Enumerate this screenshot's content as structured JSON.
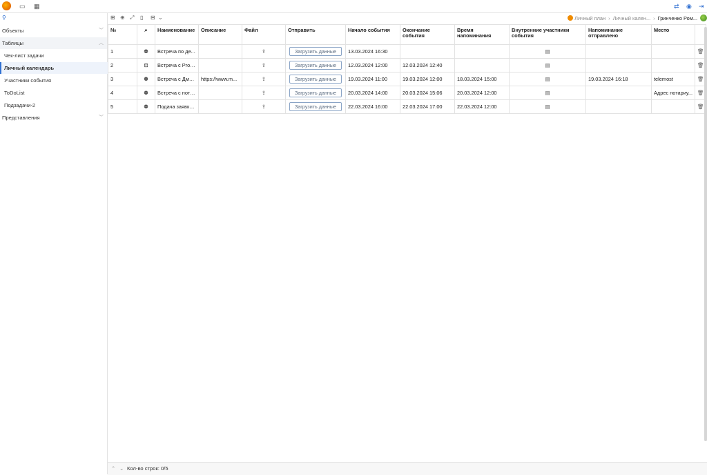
{
  "topbar": {
    "icons": [
      "monitor-icon",
      "grid-icon"
    ],
    "right_icons": [
      "swap-icon",
      "user-circle-icon",
      "logout-icon"
    ]
  },
  "sidebar": {
    "objects_label": "Объекты",
    "tables_label": "Таблицы",
    "table_items": [
      "Чек-лист задачи",
      "Личный календарь",
      "Участники события",
      "ToDoList",
      "Подзадачи-2"
    ],
    "active_item": "Личный календарь",
    "views_label": "Представления"
  },
  "breadcrumb": {
    "items": [
      "Личный план",
      "Личный кален...",
      "Гринченко Ром..."
    ]
  },
  "table": {
    "headers": [
      "№",
      "",
      "Наименование",
      "Описание",
      "Файл",
      "Отправить",
      "Начало события",
      "Окончание события",
      "Время напоминания",
      "Внутренние участники события",
      "Напоминание отправлено",
      "Место",
      ""
    ],
    "upload_label": "Загрузить данные",
    "rows": [
      {
        "num": "1",
        "name": "Встреча по де...",
        "desc": "",
        "start": "13.03.2024 16:30",
        "end": "",
        "remind": "",
        "sent": "",
        "place": ""
      },
      {
        "num": "2",
        "name": "Встреча с Prox...",
        "desc": "",
        "start": "12.03.2024 12:00",
        "end": "12.03.2024 12:40",
        "remind": "",
        "sent": "",
        "place": ""
      },
      {
        "num": "3",
        "name": "Встреча с Дми...",
        "desc": "https://www.m...",
        "start": "19.03.2024 11:00",
        "end": "19.03.2024 12:00",
        "remind": "18.03.2024 15:00",
        "sent": "19.03.2024 16:18",
        "place": "telemost"
      },
      {
        "num": "4",
        "name": "Встреча с нота...",
        "desc": "",
        "start": "20.03.2024 14:00",
        "end": "20.03.2024 15:06",
        "remind": "20.03.2024 12:00",
        "sent": "",
        "place": "Адрес нотариу..."
      },
      {
        "num": "5",
        "name": "Подача заявки...",
        "desc": "",
        "start": "22.03.2024 16:00",
        "end": "22.03.2024 17:00",
        "remind": "22.03.2024 12:00",
        "sent": "",
        "place": ""
      }
    ]
  },
  "footer": {
    "row_count": "Кол-во строк: 0/5"
  },
  "colors": {
    "accent": "#2f6fd1",
    "border": "#e2e2e2"
  }
}
